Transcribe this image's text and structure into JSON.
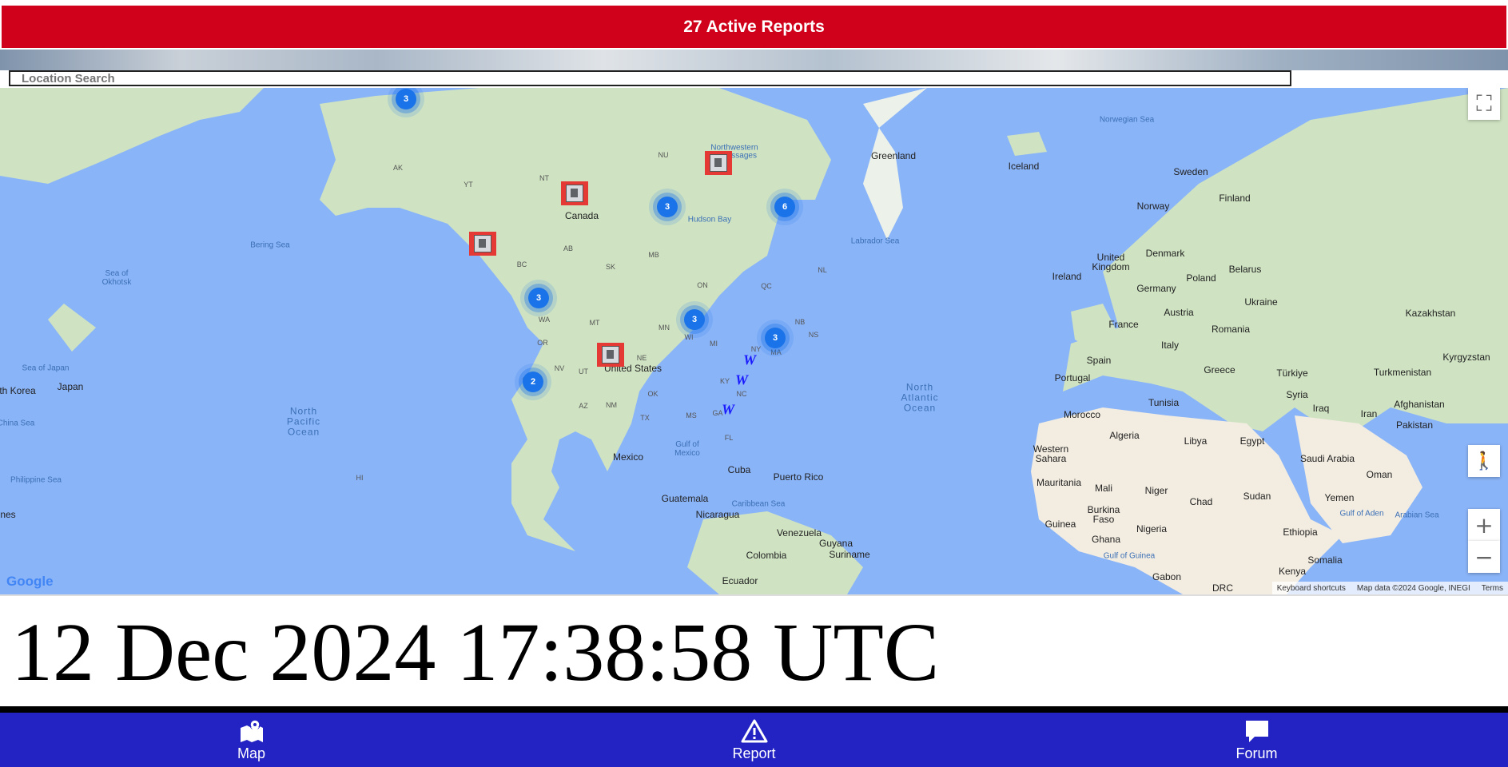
{
  "banner": {
    "text": "27 Active Reports"
  },
  "search": {
    "placeholder": "Location Search"
  },
  "map": {
    "labels": {
      "greenland": "Greenland",
      "iceland": "Iceland",
      "norwegian_sea": "Norwegian Sea",
      "sweden": "Sweden",
      "finland": "Finland",
      "norway": "Norway",
      "canada": "Canada",
      "hudson_bay": "Hudson Bay",
      "labrador_sea": "Labrador Sea",
      "nw_passages_1": "Northwestern",
      "nw_passages_2": "Passages",
      "bering_sea": "Bering Sea",
      "sea_of_okhotsk": "Sea of\nOkhotsk",
      "united_kingdom": "United\nKingdom",
      "ireland": "Ireland",
      "denmark": "Denmark",
      "poland": "Poland",
      "belarus": "Belarus",
      "germany": "Germany",
      "ukraine": "Ukraine",
      "kazakhstan": "Kazakhstan",
      "france": "France",
      "austria": "Austria",
      "romania": "Romania",
      "italy": "Italy",
      "spain": "Spain",
      "portugal": "Portugal",
      "greece": "Greece",
      "turkiye": "Türkiye",
      "turkmenistan": "Turkmenistan",
      "kyrgyzstan": "Kyrgyzstan",
      "sea_of_japan": "Sea of Japan",
      "japan": "Japan",
      "north_korea": "th Korea",
      "china_sea": "China Sea",
      "united_states": "United States",
      "north_pacific": "North\nPacific\nOcean",
      "north_atlantic": "North\nAtlantic\nOcean",
      "tunisia": "Tunisia",
      "syria": "Syria",
      "iraq": "Iraq",
      "iran": "Iran",
      "afghanistan": "Afghanistan",
      "pakistan": "Pakistan",
      "morocco": "Morocco",
      "algeria": "Algeria",
      "libya": "Libya",
      "egypt": "Egypt",
      "western_sahara": "Western\nSahara",
      "saudi_arabia": "Saudi Arabia",
      "oman": "Oman",
      "mauritania": "Mauritania",
      "mali": "Mali",
      "niger": "Niger",
      "chad": "Chad",
      "sudan": "Sudan",
      "yemen": "Yemen",
      "arabian_sea": "Arabian Sea",
      "gulf_of_aden": "Gulf of Aden",
      "burkina_faso": "Burkina\nFaso",
      "guinea": "Guinea",
      "nigeria": "Nigeria",
      "ethiopia": "Ethiopia",
      "ghana": "Ghana",
      "gulf_of_guinea": "Gulf of Guinea",
      "somalia": "Somalia",
      "kenya": "Kenya",
      "gabon": "Gabon",
      "drc": "DRC",
      "mexico": "Mexico",
      "gulf_of_mexico": "Gulf of\nMexico",
      "cuba": "Cuba",
      "puerto_rico": "Puerto Rico",
      "guatemala": "Guatemala",
      "nicaragua": "Nicaragua",
      "caribbean_sea": "Caribbean Sea",
      "venezuela": "Venezuela",
      "guyana": "Guyana",
      "suriname": "Suriname",
      "colombia": "Colombia",
      "ecuador": "Ecuador",
      "philippine_sea": "Philippine Sea",
      "nes": "nes",
      "hi": "HI"
    },
    "provinces": [
      "AK",
      "YT",
      "NT",
      "NU",
      "BC",
      "AB",
      "SK",
      "MB",
      "ON",
      "QC",
      "NL",
      "NB",
      "NS",
      "WA",
      "OR",
      "CA",
      "NV",
      "UT",
      "MT",
      "NE",
      "MN",
      "WI",
      "MI",
      "NY",
      "MA",
      "KY",
      "NC",
      "OK",
      "TX",
      "NM",
      "AZ",
      "FL",
      "MS",
      "GA"
    ],
    "clusters": [
      "3",
      "3",
      "6",
      "3",
      "3",
      "3",
      "2"
    ],
    "google_logo": "Google",
    "attribution": {
      "shortcuts": "Keyboard shortcuts",
      "data": "Map data ©2024 Google, INEGI",
      "terms": "Terms"
    }
  },
  "clock": {
    "text": "12 Dec 2024 17:38:58 UTC"
  },
  "nav": [
    {
      "label": "Map",
      "icon": "map-icon"
    },
    {
      "label": "Report",
      "icon": "warning-icon"
    },
    {
      "label": "Forum",
      "icon": "chat-icon"
    }
  ]
}
